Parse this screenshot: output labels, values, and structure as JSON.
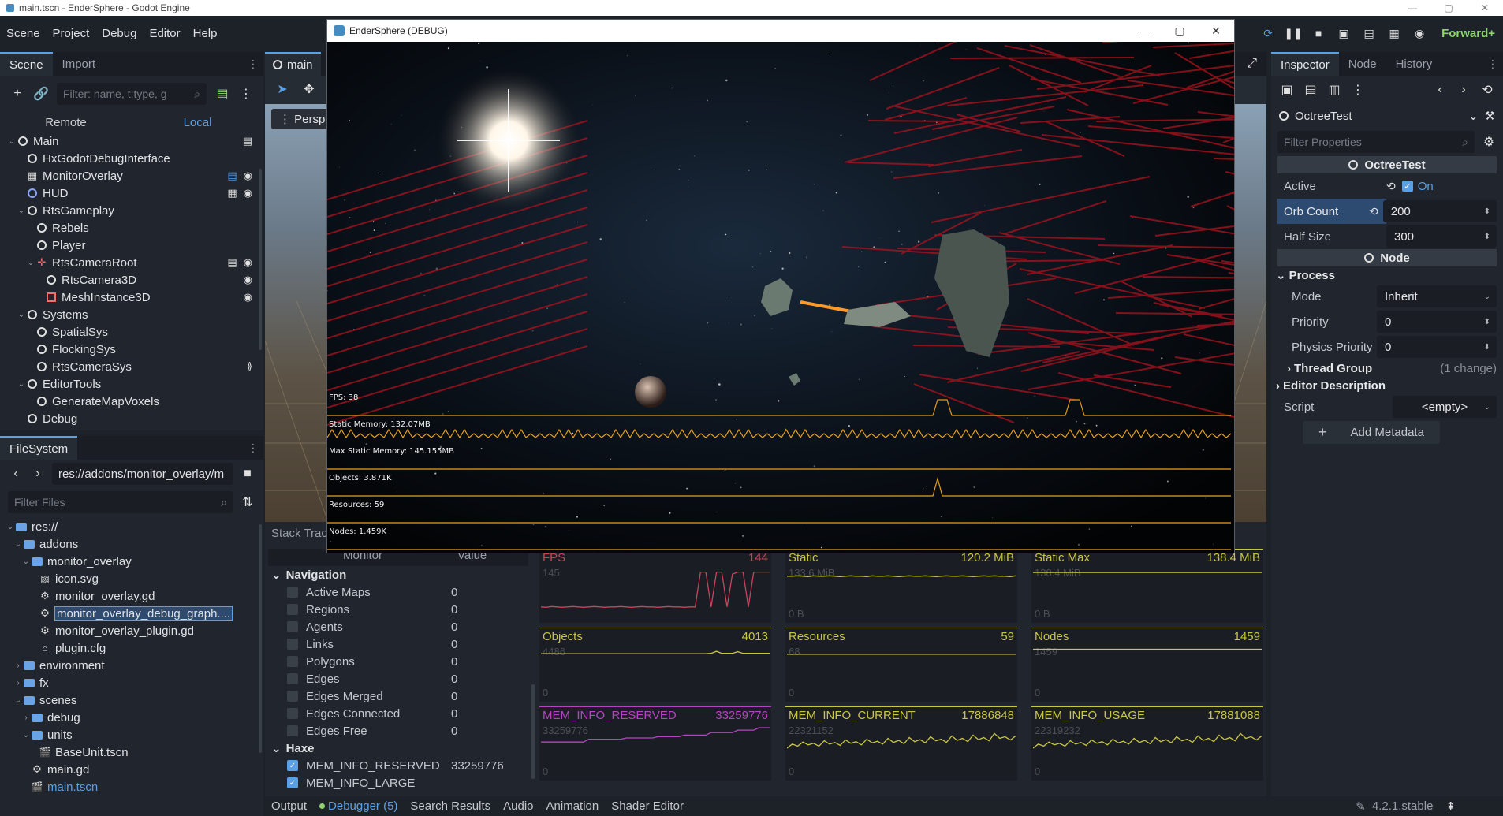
{
  "os_title": "main.tscn - EnderSphere - Godot Engine",
  "menu": [
    "Scene",
    "Project",
    "Debug",
    "Editor",
    "Help"
  ],
  "renderer": "Forward+",
  "scene_dock": {
    "tabs": [
      "Scene",
      "Import"
    ],
    "filter_placeholder": "Filter: name, t:type, g",
    "remote": "Remote",
    "local": "Local",
    "tree": [
      {
        "label": "Main",
        "depth": 0,
        "arrow": "v",
        "icon": "node"
      },
      {
        "label": "HxGodotDebugInterface",
        "depth": 1,
        "arrow": "",
        "icon": "node"
      },
      {
        "label": "MonitorOverlay",
        "depth": 1,
        "arrow": "",
        "icon": "grid"
      },
      {
        "label": "HUD",
        "depth": 1,
        "arrow": "",
        "icon": "canvas"
      },
      {
        "label": "RtsGameplay",
        "depth": 1,
        "arrow": "v",
        "icon": "node"
      },
      {
        "label": "Rebels",
        "depth": 2,
        "arrow": "",
        "icon": "node"
      },
      {
        "label": "Player",
        "depth": 2,
        "arrow": "",
        "icon": "node"
      },
      {
        "label": "RtsCameraRoot",
        "depth": 2,
        "arrow": "v",
        "icon": "node3d"
      },
      {
        "label": "RtsCamera3D",
        "depth": 3,
        "arrow": "",
        "icon": "node"
      },
      {
        "label": "MeshInstance3D",
        "depth": 3,
        "arrow": "",
        "icon": "mesh"
      },
      {
        "label": "Systems",
        "depth": 1,
        "arrow": "v",
        "icon": "node"
      },
      {
        "label": "SpatialSys",
        "depth": 2,
        "arrow": "",
        "icon": "node"
      },
      {
        "label": "FlockingSys",
        "depth": 2,
        "arrow": "",
        "icon": "node"
      },
      {
        "label": "RtsCameraSys",
        "depth": 2,
        "arrow": "",
        "icon": "node"
      },
      {
        "label": "EditorTools",
        "depth": 1,
        "arrow": "v",
        "icon": "node"
      },
      {
        "label": "GenerateMapVoxels",
        "depth": 2,
        "arrow": "",
        "icon": "node"
      },
      {
        "label": "Debug",
        "depth": 1,
        "arrow": "",
        "icon": "node"
      }
    ]
  },
  "fs_dock": {
    "tab": "FileSystem",
    "path": "res://addons/monitor_overlay/m",
    "filter_placeholder": "Filter Files",
    "tree": [
      {
        "label": "res://",
        "depth": 0,
        "arrow": "v",
        "icon": "folder"
      },
      {
        "label": "addons",
        "depth": 1,
        "arrow": "v",
        "icon": "folder"
      },
      {
        "label": "monitor_overlay",
        "depth": 2,
        "arrow": "v",
        "icon": "folder"
      },
      {
        "label": "icon.svg",
        "depth": 3,
        "arrow": "",
        "icon": "image"
      },
      {
        "label": "monitor_overlay.gd",
        "depth": 3,
        "arrow": "",
        "icon": "gear"
      },
      {
        "label": "monitor_overlay_debug_graph....",
        "depth": 3,
        "arrow": "",
        "icon": "gear",
        "selected": true
      },
      {
        "label": "monitor_overlay_plugin.gd",
        "depth": 3,
        "arrow": "",
        "icon": "gear"
      },
      {
        "label": "plugin.cfg",
        "depth": 3,
        "arrow": "",
        "icon": "plug"
      },
      {
        "label": "environment",
        "depth": 1,
        "arrow": ">",
        "icon": "folder"
      },
      {
        "label": "fx",
        "depth": 1,
        "arrow": ">",
        "icon": "folder"
      },
      {
        "label": "scenes",
        "depth": 1,
        "arrow": "v",
        "icon": "folder"
      },
      {
        "label": "debug",
        "depth": 2,
        "arrow": ">",
        "icon": "folder"
      },
      {
        "label": "units",
        "depth": 2,
        "arrow": "v",
        "icon": "folder"
      },
      {
        "label": "BaseUnit.tscn",
        "depth": 3,
        "arrow": "",
        "icon": "scene"
      },
      {
        "label": "main.gd",
        "depth": 2,
        "arrow": "",
        "icon": "gear"
      },
      {
        "label": "main.tscn",
        "depth": 2,
        "arrow": "",
        "icon": "scene",
        "blue": true
      }
    ]
  },
  "viewport": {
    "tab": "main",
    "perspective": "Perspe"
  },
  "debug_window": {
    "title": "EnderSphere (DEBUG)",
    "overlays": [
      {
        "label": "FPS: 38",
        "color": "#e09a1a"
      },
      {
        "label": "Static Memory: 132.07MB",
        "color": "#e8a11c"
      },
      {
        "label": "Max Static Memory: 145.155MB",
        "color": "#e8a11c"
      },
      {
        "label": "Objects: 3.871K",
        "color": "#e8a11c"
      },
      {
        "label": "Resources: 59",
        "color": "#e8a11c"
      },
      {
        "label": "Nodes: 1.459K",
        "color": "#e8a11c"
      }
    ]
  },
  "inspector": {
    "tabs": [
      "Inspector",
      "Node",
      "History"
    ],
    "object": "OctreeTest",
    "filter_placeholder": "Filter Properties",
    "section": "OctreeTest",
    "active_label": "Active",
    "active_value": "On",
    "orb_count_label": "Orb Count",
    "orb_count": "200",
    "half_size_label": "Half Size",
    "half_size": "300",
    "node_section": "Node",
    "process_group": "Process",
    "mode_label": "Mode",
    "mode_value": "Inherit",
    "priority_label": "Priority",
    "priority_value": "0",
    "physics_priority_label": "Physics Priority",
    "physics_priority_value": "0",
    "thread_group": "Thread Group",
    "thread_group_note": "(1 change)",
    "editor_description": "Editor Description",
    "script_label": "Script",
    "script_value": "<empty>",
    "add_metadata": "Add Metadata"
  },
  "debugger": {
    "stack_trace_tab": "Stack Trac",
    "monitor_header": "Monitor",
    "value_header": "Value",
    "groups": [
      {
        "name": "Navigation",
        "rows": [
          {
            "name": "Active Maps",
            "value": "0",
            "checked": false
          },
          {
            "name": "Regions",
            "value": "0",
            "checked": false
          },
          {
            "name": "Agents",
            "value": "0",
            "checked": false
          },
          {
            "name": "Links",
            "value": "0",
            "checked": false
          },
          {
            "name": "Polygons",
            "value": "0",
            "checked": false
          },
          {
            "name": "Edges",
            "value": "0",
            "checked": false
          },
          {
            "name": "Edges Merged",
            "value": "0",
            "checked": false
          },
          {
            "name": "Edges Connected",
            "value": "0",
            "checked": false
          },
          {
            "name": "Edges Free",
            "value": "0",
            "checked": false
          }
        ]
      },
      {
        "name": "Haxe",
        "rows": [
          {
            "name": "MEM_INFO_RESERVED",
            "value": "33259776",
            "checked": true
          },
          {
            "name": "MEM_INFO_LARGE",
            "value": "",
            "checked": true
          }
        ]
      }
    ],
    "graphs": [
      {
        "name": "FPS",
        "value": "144",
        "max": "145",
        "min": "",
        "color": "#c8455a",
        "series": [
          10,
          9,
          11,
          10,
          9,
          10,
          11,
          10,
          9,
          10,
          11,
          10,
          9,
          10,
          10,
          11,
          10,
          9,
          10,
          11,
          10,
          10,
          9,
          10,
          11,
          10,
          10,
          9,
          10,
          10,
          95,
          95,
          10,
          95,
          95,
          10,
          90,
          95,
          95,
          10,
          95,
          95,
          95,
          95
        ]
      },
      {
        "name": "Static",
        "value": "120.2 MiB",
        "max": "133.6 MiB",
        "min": "0 B",
        "color": "#c9c640",
        "series": [
          85,
          85,
          86,
          85,
          84,
          86,
          85,
          85,
          86,
          85,
          84,
          85,
          86,
          85,
          85,
          84,
          86,
          85,
          85,
          86,
          85,
          84,
          85,
          86,
          85,
          85,
          86,
          85,
          84,
          85,
          86,
          85,
          85,
          86,
          85,
          84,
          85,
          86,
          85,
          86,
          85,
          85,
          84,
          86
        ]
      },
      {
        "name": "Static Max",
        "value": "138.4 MiB",
        "max": "138.4 MiB",
        "min": "0 B",
        "color": "#c9c640",
        "series": [
          94,
          94,
          94,
          94,
          94,
          94,
          94,
          94,
          94,
          94,
          94,
          94,
          94,
          94,
          94,
          94,
          94,
          94,
          94,
          94,
          94,
          94,
          94,
          94,
          94,
          94,
          94,
          94,
          94,
          94,
          94,
          94,
          94,
          94,
          94,
          94,
          94,
          94,
          94,
          94,
          94,
          94,
          94,
          94
        ]
      },
      {
        "name": "Objects",
        "value": "4013",
        "max": "4486",
        "min": "0",
        "color": "#c9c640",
        "series": [
          88,
          88,
          88,
          88,
          88,
          88,
          88,
          88,
          88,
          88,
          88,
          88,
          88,
          88,
          88,
          88,
          88,
          88,
          88,
          88,
          88,
          88,
          88,
          88,
          88,
          88,
          88,
          88,
          88,
          88,
          88,
          88,
          89,
          94,
          89,
          89,
          89,
          93,
          89,
          89,
          89,
          89,
          89,
          89
        ]
      },
      {
        "name": "Resources",
        "value": "59",
        "max": "68",
        "min": "0",
        "color": "#c9c640",
        "series": [
          87,
          87,
          87,
          87,
          87,
          87,
          87,
          87,
          87,
          87,
          87,
          87,
          87,
          87,
          87,
          87,
          87,
          87,
          87,
          87,
          87,
          87,
          87,
          87,
          87,
          87,
          87,
          87,
          87,
          87,
          87,
          87,
          87,
          87,
          87,
          87,
          87,
          87,
          87,
          87,
          87,
          87,
          87,
          87
        ]
      },
      {
        "name": "Nodes",
        "value": "1459",
        "max": "1459",
        "min": "0",
        "color": "#c9c640",
        "series": [
          99,
          99,
          99,
          99,
          99,
          99,
          99,
          99,
          99,
          99,
          99,
          99,
          99,
          99,
          99,
          99,
          99,
          99,
          99,
          99,
          99,
          99,
          99,
          99,
          99,
          99,
          99,
          99,
          99,
          99,
          99,
          99,
          99,
          99,
          99,
          99,
          99,
          99,
          99,
          99,
          99,
          99,
          99,
          99
        ]
      },
      {
        "name": "MEM_INFO_RESERVED",
        "value": "33259776",
        "max": "33259776",
        "min": "0",
        "color": "#b445c0",
        "series": [
          65,
          65,
          65,
          65,
          65,
          65,
          65,
          65,
          65,
          72,
          72,
          72,
          72,
          72,
          72,
          72,
          75,
          75,
          75,
          75,
          75,
          75,
          78,
          78,
          78,
          78,
          78,
          82,
          82,
          82,
          82,
          82,
          88,
          88,
          88,
          88,
          88,
          94,
          94,
          94,
          94,
          100,
          100,
          100
        ]
      },
      {
        "name": "MEM_INFO_CURRENT",
        "value": "17886848",
        "max": "22321152",
        "min": "0",
        "color": "#c9c640",
        "series": [
          50,
          60,
          55,
          65,
          58,
          62,
          55,
          68,
          60,
          64,
          57,
          70,
          62,
          66,
          58,
          72,
          63,
          67,
          60,
          74,
          64,
          69,
          61,
          76,
          66,
          71,
          63,
          78,
          68,
          72,
          64,
          80,
          69,
          74,
          66,
          82,
          71,
          76,
          68,
          86,
          74,
          78,
          70,
          80
        ]
      },
      {
        "name": "MEM_INFO_USAGE",
        "value": "17881088",
        "max": "22319232",
        "min": "0",
        "color": "#c9c640",
        "series": [
          50,
          60,
          55,
          65,
          58,
          62,
          55,
          68,
          60,
          64,
          57,
          70,
          62,
          66,
          58,
          72,
          63,
          67,
          60,
          74,
          64,
          69,
          61,
          76,
          66,
          71,
          63,
          78,
          68,
          72,
          64,
          80,
          69,
          74,
          66,
          82,
          71,
          76,
          68,
          86,
          74,
          78,
          70,
          80
        ]
      }
    ]
  },
  "bottom_tabs": [
    "Output",
    "Debugger (5)",
    "Search Results",
    "Audio",
    "Animation",
    "Shader Editor"
  ],
  "version": "4.2.1.stable"
}
